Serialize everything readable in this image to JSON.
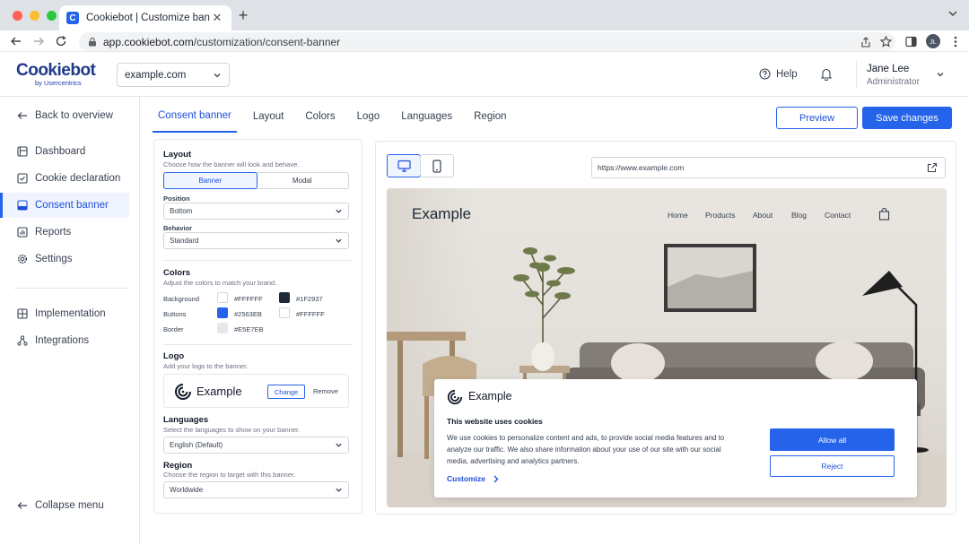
{
  "browser": {
    "tab_title": "Cookiebot | Customize banner",
    "favicon_letter": "C",
    "url_domain": "app.cookiebot.com",
    "url_path": "/customization/consent-banner",
    "profile_initials": "JL"
  },
  "header": {
    "logo_main": "Cookiebot",
    "logo_sub": "by Usercentrics",
    "site_selector": "example.com",
    "help_label": "Help",
    "user_name": "Jane Lee",
    "user_role": "Administrator"
  },
  "sidebar": {
    "back_label": "Back to overview",
    "items": [
      {
        "label": "Dashboard",
        "icon": "dashboard-icon"
      },
      {
        "label": "Cookie declaration",
        "icon": "check-doc-icon"
      },
      {
        "label": "Consent banner",
        "icon": "banner-icon"
      },
      {
        "label": "Reports",
        "icon": "bar-chart-icon"
      },
      {
        "label": "Settings",
        "icon": "gear-icon"
      },
      {
        "label": "Implementation",
        "icon": "grid-icon"
      },
      {
        "label": "Integrations",
        "icon": "nodes-icon"
      }
    ],
    "collapse_label": "Collapse menu"
  },
  "tabs": [
    "Consent banner",
    "Layout",
    "Colors",
    "Logo",
    "Languages",
    "Region"
  ],
  "actions": {
    "preview": "Preview",
    "save": "Save changes"
  },
  "panel": {
    "layout": {
      "title": "Layout",
      "desc": "Choose how the banner will look and behave.",
      "options": [
        "Banner",
        "Modal"
      ],
      "position_label": "Position",
      "position_value": "Bottom",
      "behavior_label": "Behavior",
      "behavior_value": "Standard"
    },
    "colors": {
      "title": "Colors",
      "desc": "Adjust the colors to match your brand.",
      "rows": [
        {
          "label": "Background",
          "c1": "#FFFFFF",
          "c2": "#1F2937"
        },
        {
          "label": "Buttons",
          "c1": "#2563EB",
          "c2": "#FFFFFF"
        },
        {
          "label": "Border",
          "c1": "#E5E7EB"
        }
      ]
    },
    "logo": {
      "title": "Logo",
      "desc": "Add your logo to the banner.",
      "name": "Example",
      "change": "Change",
      "remove": "Remove"
    },
    "languages": {
      "title": "Languages",
      "desc": "Select the languages to show on your banner.",
      "value": "English (Default)"
    },
    "region": {
      "title": "Region",
      "desc": "Choose the region to target with this banner.",
      "value": "Worldwide"
    }
  },
  "preview": {
    "url": "https://www.example.com",
    "site_brand": "Example",
    "site_nav": [
      "Home",
      "Products",
      "About",
      "Blog",
      "Contact"
    ],
    "banner": {
      "brand": "Example",
      "title": "This website uses cookies",
      "body": "We use cookies to personalize content and ads, to provide social media features and to analyze our traffic. We also share information about your use of our site with our social media, advertising and analytics partners.",
      "customize": "Customize",
      "allow": "Allow all",
      "reject": "Reject"
    }
  },
  "colors": {
    "accent": "#2563EB",
    "text": "#1F2937"
  }
}
